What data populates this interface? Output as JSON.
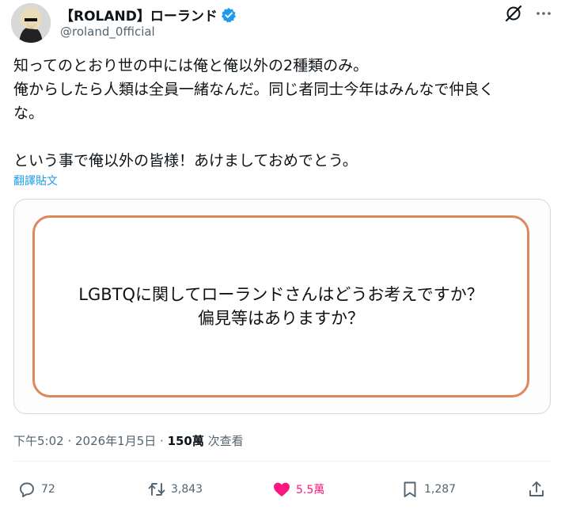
{
  "post": {
    "author": {
      "display_name": "【ROLAND】ローランド",
      "handle": "@roland_0fficial",
      "verified": true
    },
    "text_lines": [
      "知ってのとおり世の中には俺と俺以外の2種類のみ。",
      "俺からしたら人類は全員一緒なんだ。同じ者同士今年はみんなで仲良く",
      "な。",
      "という事で俺以外の皆様！あけましておめでとう。"
    ],
    "translate_label": "翻譯貼文",
    "media": {
      "line1": "LGBTQに関してローランドさんはどうお考えですか？",
      "line2": "偏見等はありますか？"
    },
    "timestamp": "下午5:02 · 2026年1月5日 · ",
    "views_count": "150萬",
    "views_label": " 次查看"
  },
  "actions": {
    "replies": "72",
    "reposts": "3,843",
    "likes": "5.5萬",
    "bookmarks": "1,287"
  },
  "colors": {
    "accent": "#1d9bf0",
    "like": "#f91880",
    "media_border": "#e0865c",
    "muted": "#536471"
  },
  "icons": [
    "grok-icon",
    "more-icon",
    "verified-badge-icon",
    "reply-icon",
    "repost-icon",
    "like-heart-icon",
    "bookmark-icon",
    "share-icon"
  ]
}
